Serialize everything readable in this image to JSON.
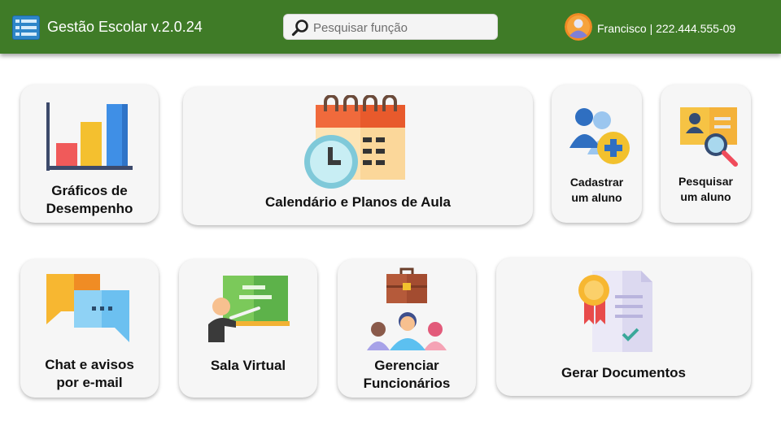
{
  "header": {
    "title": "Gestão Escolar v.2.0.24",
    "search_placeholder": "Pesquisar função",
    "user_info": "Francisco | 222.444.555-09",
    "menu_icon": "hamburger-menu-icon",
    "avatar_icon": "user-avatar-icon"
  },
  "colors": {
    "header_bg": "#3f7b27",
    "card_bg": "#f6f6f6",
    "text": "#111111"
  },
  "cards": {
    "graficos": {
      "label_line1": "Gráficos de",
      "label_line2": "Desempenho",
      "icon": "bar-chart-icon"
    },
    "calendario": {
      "label": "Calendário e Planos de Aula",
      "icon": "calendar-clock-icon"
    },
    "cadastrar": {
      "label_line1": "Cadastrar",
      "label_line2": "um aluno",
      "icon": "add-user-icon"
    },
    "pesquisar": {
      "label_line1": "Pesquisar",
      "label_line2": "um aluno",
      "icon": "id-card-search-icon"
    },
    "chat": {
      "label_line1": "Chat e avisos",
      "label_line2": "por e-mail",
      "icon": "chat-bubbles-icon"
    },
    "sala": {
      "label": "Sala Virtual",
      "icon": "teacher-board-icon"
    },
    "gerenciar": {
      "label_line1": "Gerenciar",
      "label_line2": "Funcionários",
      "icon": "staff-briefcase-icon"
    },
    "documentos": {
      "label": "Gerar Documentos",
      "icon": "certificate-document-icon"
    }
  }
}
